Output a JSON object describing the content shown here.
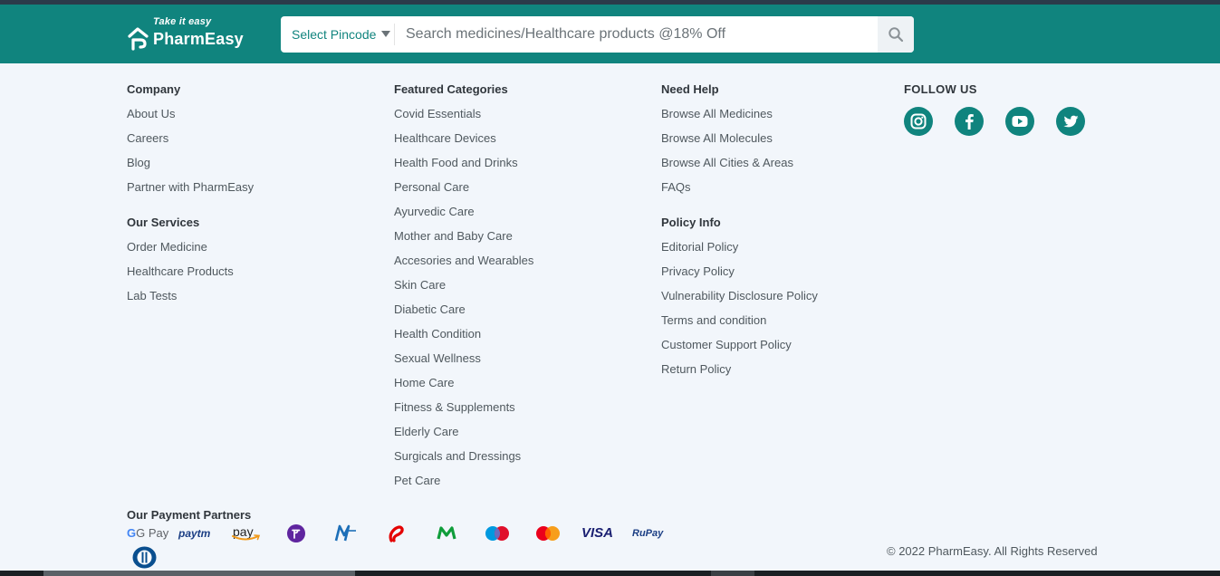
{
  "header": {
    "logo_tagline": "Take it easy",
    "logo_name": "PharmEasy",
    "pincode_label": "Select Pincode",
    "search_placeholder": "Search medicines/Healthcare products @18% Off",
    "brand_color": "#10847e"
  },
  "footer": {
    "company": {
      "heading": "Company",
      "links": [
        "About Us",
        "Careers",
        "Blog",
        "Partner with PharmEasy"
      ]
    },
    "our_services": {
      "heading": "Our Services",
      "links": [
        "Order Medicine",
        "Healthcare Products",
        "Lab Tests"
      ]
    },
    "featured_categories": {
      "heading": "Featured Categories",
      "links": [
        "Covid Essentials",
        "Healthcare Devices",
        "Health Food and Drinks",
        "Personal Care",
        "Ayurvedic Care",
        "Mother and Baby Care",
        "Accesories and Wearables",
        "Skin Care",
        "Diabetic Care",
        "Health Condition",
        "Sexual Wellness",
        "Home Care",
        "Fitness & Supplements",
        "Elderly Care",
        "Surgicals and Dressings",
        "Pet Care"
      ]
    },
    "need_help": {
      "heading": "Need Help",
      "links": [
        "Browse All Medicines",
        "Browse All Molecules",
        "Browse All Cities & Areas",
        "FAQs"
      ]
    },
    "policy_info": {
      "heading": "Policy Info",
      "links": [
        "Editorial Policy",
        "Privacy Policy",
        "Vulnerability Disclosure Policy",
        "Terms and condition",
        "Customer Support Policy",
        "Return Policy"
      ]
    },
    "follow_us": {
      "heading": "FOLLOW US",
      "icons": [
        "instagram-icon",
        "facebook-icon",
        "youtube-icon",
        "twitter-icon"
      ]
    },
    "payment_partners": {
      "heading": "Our Payment Partners",
      "gpay": "G Pay",
      "paytm": "paytm",
      "amazon_pay": "pay",
      "visa": "VISA",
      "rupay": "RuPay",
      "logos": [
        "gpay-logo",
        "paytm-logo",
        "amazon-pay-logo",
        "phonepe-logo",
        "mobikwik-logo",
        "airtel-logo",
        "m-logo",
        "maestro-logo",
        "mastercard-logo",
        "visa-logo",
        "rupay-logo",
        "diners-club-logo"
      ]
    },
    "copyright": "© 2022 PharmEasy. All Rights Reserved"
  }
}
